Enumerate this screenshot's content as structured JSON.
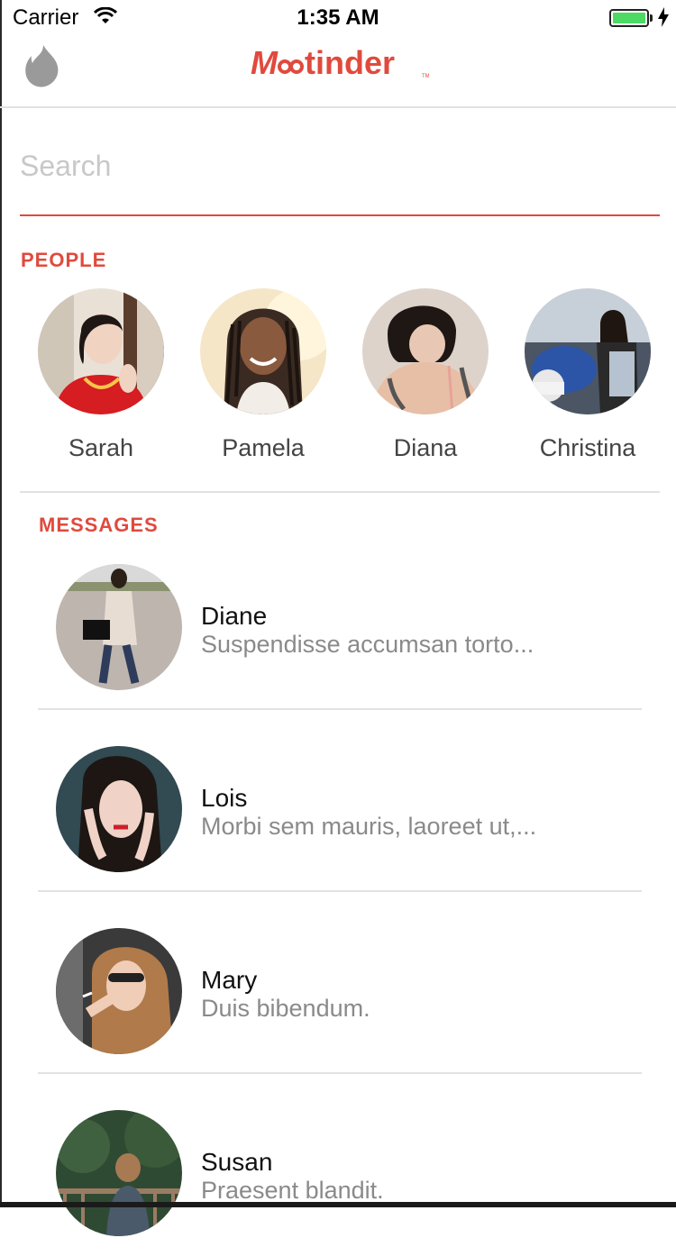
{
  "status": {
    "carrier": "Carrier",
    "time": "1:35 AM"
  },
  "nav": {
    "logo_text": "Meetinder",
    "brand_color": "#e04a3d"
  },
  "search": {
    "placeholder": "Search",
    "value": ""
  },
  "people": {
    "title": "PEOPLE",
    "items": [
      {
        "name": "Sarah"
      },
      {
        "name": "Pamela"
      },
      {
        "name": "Diana"
      },
      {
        "name": "Christina"
      }
    ]
  },
  "messages": {
    "title": "MESSAGES",
    "items": [
      {
        "name": "Diane",
        "preview": "Suspendisse accumsan torto..."
      },
      {
        "name": "Lois",
        "preview": "Morbi sem mauris, laoreet ut,..."
      },
      {
        "name": "Mary",
        "preview": "Duis bibendum."
      },
      {
        "name": "Susan",
        "preview": "Praesent blandit."
      }
    ]
  }
}
